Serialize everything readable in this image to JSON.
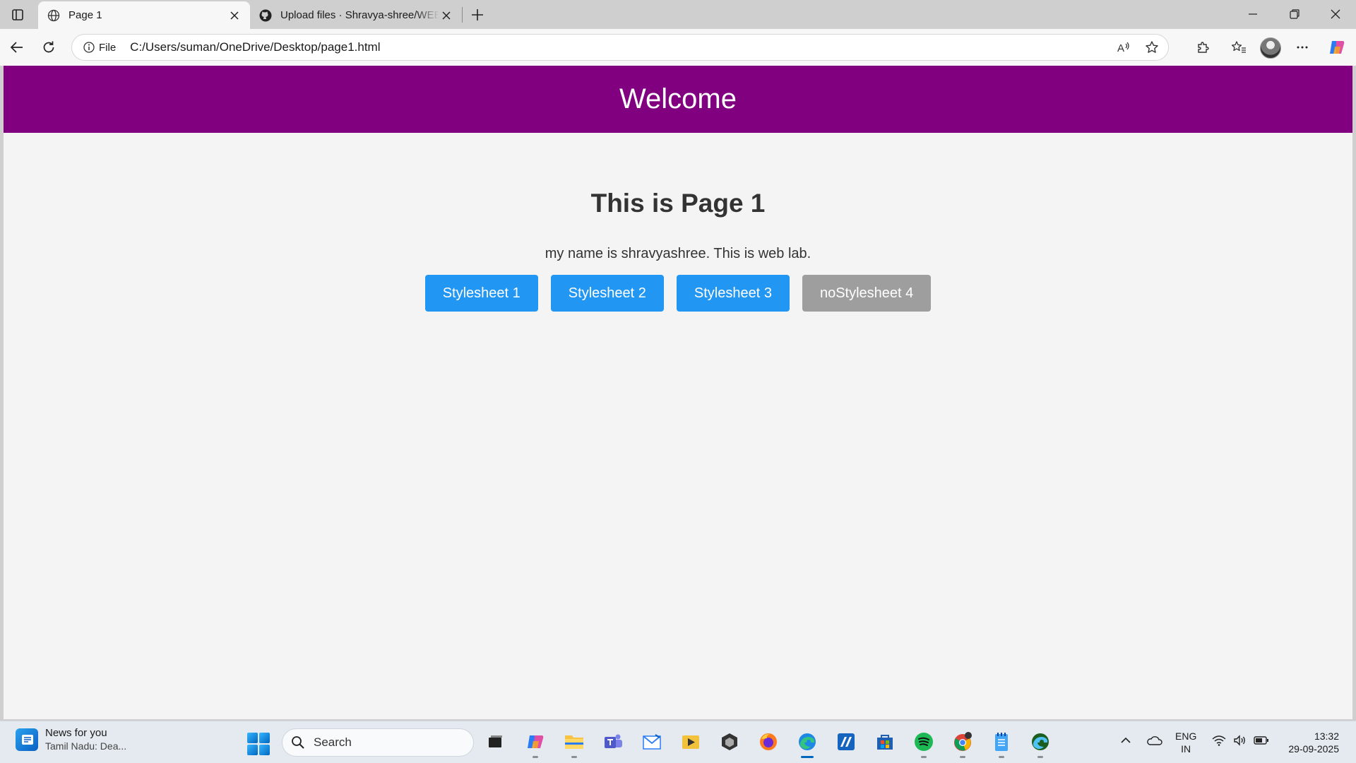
{
  "browser": {
    "tabs": [
      {
        "title": "Page 1",
        "icon": "globe-icon",
        "active": true
      },
      {
        "title": "Upload files · Shravya-shree/WEB",
        "icon": "github-icon",
        "active": false
      }
    ],
    "address": {
      "scheme_label": "File",
      "url": "C:/Users/suman/OneDrive/Desktop/page1.html"
    }
  },
  "page": {
    "header_title": "Welcome",
    "heading": "This is Page 1",
    "paragraph": "my name is shravyashree. This is web lab.",
    "buttons": [
      {
        "label": "Stylesheet 1",
        "color": "#2196f3"
      },
      {
        "label": "Stylesheet 2",
        "color": "#2196f3"
      },
      {
        "label": "Stylesheet 3",
        "color": "#2196f3"
      },
      {
        "label": "noStylesheet 4",
        "color": "#9e9e9e"
      }
    ],
    "colors": {
      "header_bg": "#800080",
      "body_bg": "#f4f4f4"
    }
  },
  "taskbar": {
    "news": {
      "title": "News for you",
      "subtitle": "Tamil Nadu: Dea..."
    },
    "search_placeholder": "Search",
    "apps": [
      "task-view-icon",
      "copilot-icon",
      "file-explorer-icon",
      "teams-icon",
      "mail-icon",
      "media-icon",
      "unity-icon",
      "firefox-icon",
      "edge-icon",
      "editor-icon",
      "store-icon",
      "spotify-icon",
      "chrome-icon",
      "notepad-icon",
      "edge-dev-icon"
    ],
    "language": {
      "line1": "ENG",
      "line2": "IN"
    },
    "clock": {
      "time": "13:32",
      "date": "29-09-2025"
    }
  }
}
